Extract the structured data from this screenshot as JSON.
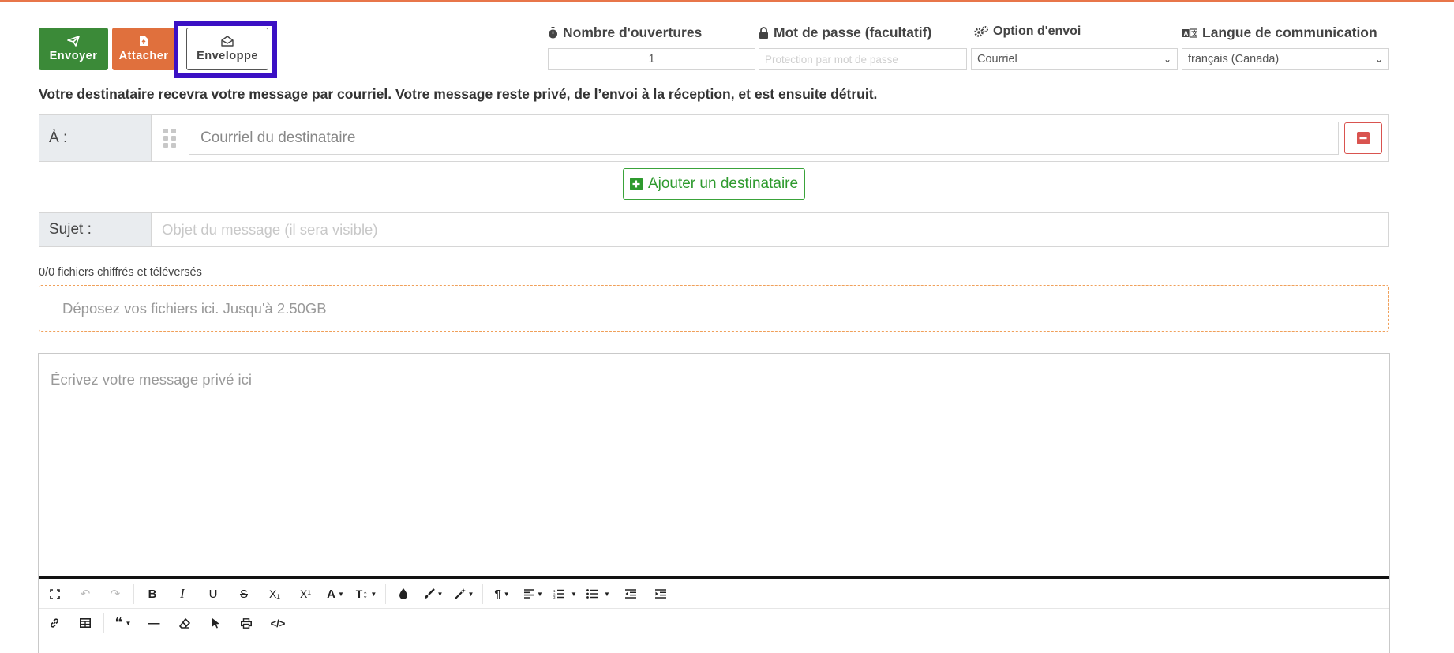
{
  "actions": {
    "send_label": "Envoyer",
    "attach_label": "Attacher",
    "envelope_label": "Enveloppe"
  },
  "options": {
    "opens": {
      "label": "Nombre d'ouvertures",
      "value": "1"
    },
    "password": {
      "label": "Mot de passe (facultatif)",
      "placeholder": "Protection par mot de passe"
    },
    "send_option": {
      "label": "Option d'envoi",
      "value": "Courriel"
    },
    "language": {
      "label": "Langue de communication",
      "value": "français (Canada)"
    }
  },
  "info_text": "Votre destinataire recevra votre message par courriel. Votre message reste privé, de l’envoi à la réception, et est ensuite détruit.",
  "recipient": {
    "label": "À :",
    "placeholder": "Courriel du destinataire",
    "add_label": "Ajouter un destinataire"
  },
  "subject": {
    "label": "Sujet :",
    "placeholder": "Objet du message (il sera visible)"
  },
  "files": {
    "count_text": "0/0 fichiers chiffrés et téléversés",
    "dropzone_text": "Déposez vos fichiers ici. Jusqu'à 2.50GB"
  },
  "editor": {
    "placeholder": "Écrivez votre message privé ici"
  },
  "colors": {
    "send": "#3b8a38",
    "attach": "#e0703d",
    "highlight": "#3b10c4",
    "danger": "#d9534f",
    "success": "#2e9a2e"
  },
  "toolbar": {
    "row1": [
      {
        "icon": "fullscreen-icon",
        "glyph": "⛶",
        "disabled": false
      },
      {
        "icon": "undo-icon",
        "glyph": "↶",
        "disabled": true
      },
      {
        "icon": "redo-icon",
        "glyph": "↷",
        "disabled": true
      },
      {
        "icon": "bold-icon",
        "glyph": "B"
      },
      {
        "icon": "italic-icon",
        "glyph": "I"
      },
      {
        "icon": "underline-icon",
        "glyph": "U"
      },
      {
        "icon": "strikethrough-icon",
        "glyph": "S"
      },
      {
        "icon": "subscript-icon",
        "glyph": "X₁"
      },
      {
        "icon": "superscript-icon",
        "glyph": "X¹"
      },
      {
        "icon": "font-family-icon",
        "glyph": "A"
      },
      {
        "icon": "font-size-icon",
        "glyph": "T↕"
      },
      {
        "icon": "text-color-icon",
        "glyph": "●"
      },
      {
        "icon": "paint-brush-icon",
        "glyph": "✎"
      },
      {
        "icon": "magic-wand-icon",
        "glyph": "✦"
      },
      {
        "icon": "paragraph-icon",
        "glyph": "¶"
      },
      {
        "icon": "align-icon",
        "glyph": "≡"
      },
      {
        "icon": "ordered-list-icon",
        "glyph": "⒈"
      },
      {
        "icon": "unordered-list-icon",
        "glyph": "•≡"
      },
      {
        "icon": "outdent-icon",
        "glyph": "⇤"
      },
      {
        "icon": "indent-icon",
        "glyph": "⇥"
      }
    ],
    "row2": [
      {
        "icon": "link-icon",
        "glyph": "🔗"
      },
      {
        "icon": "table-icon",
        "glyph": "▦"
      },
      {
        "icon": "quote-icon",
        "glyph": "❝"
      },
      {
        "icon": "horizontal-line-icon",
        "glyph": "—"
      },
      {
        "icon": "eraser-icon",
        "glyph": "⌫"
      },
      {
        "icon": "select-all-icon",
        "glyph": "➤"
      },
      {
        "icon": "print-icon",
        "glyph": "⎙"
      },
      {
        "icon": "code-view-icon",
        "glyph": "</>"
      }
    ]
  }
}
